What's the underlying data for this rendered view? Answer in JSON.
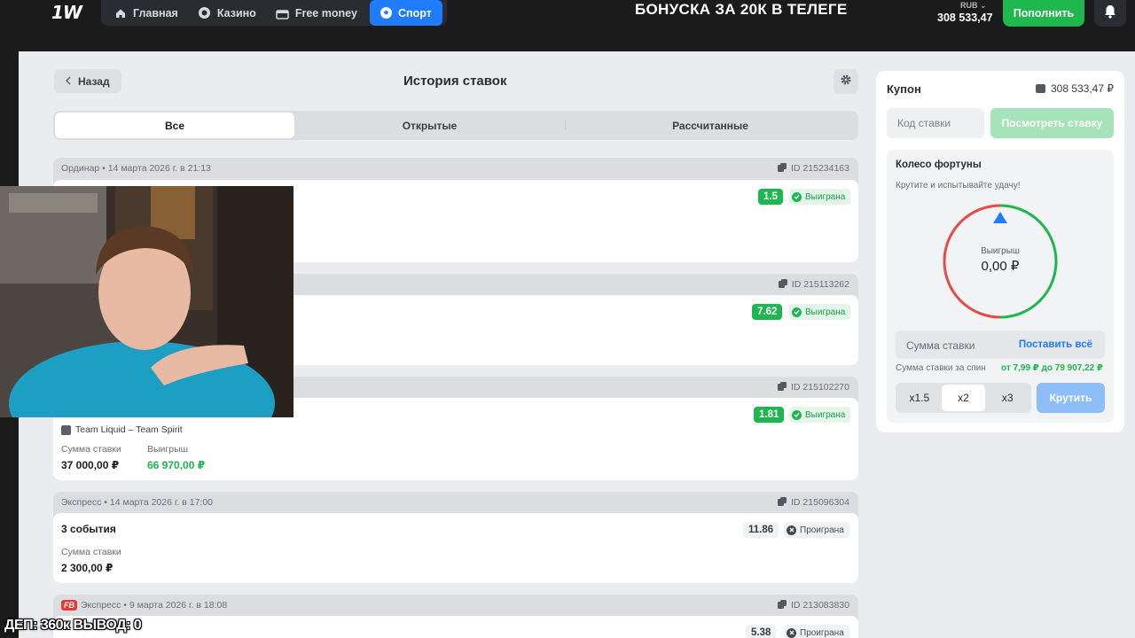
{
  "header": {
    "logo": "1W",
    "nav": [
      {
        "label": "Главная",
        "icon": "home-icon"
      },
      {
        "label": "Казино",
        "icon": "casino-chip-icon"
      },
      {
        "label": "Free money",
        "icon": "gift-icon"
      },
      {
        "label": "Спорт",
        "icon": "soccer-ball-icon",
        "active": true
      }
    ],
    "promo_text": "БОНУСКА ЗА 20К В ТЕЛЕГЕ",
    "balance_currency": "RUB",
    "balance_value": "308 533,47",
    "topup_label": "Пополнить",
    "accent_color": "#1f7bff",
    "success_color": "#1db650"
  },
  "page": {
    "back_label": "Назад",
    "title": "История ставок",
    "tabs": [
      {
        "label": "Все",
        "active": true
      },
      {
        "label": "Открытые"
      },
      {
        "label": "Рассчитанные"
      }
    ]
  },
  "bets": [
    {
      "head": "Ординар • 14 марта 2026 г. в 21:13",
      "id": "ID 215234163",
      "coef": "1.5",
      "status": "Выиграна"
    },
    {
      "id": "ID 215113262",
      "coef": "7.62",
      "status": "Выиграна"
    },
    {
      "id": "ID 215102270",
      "coef": "1.81",
      "status": "Выиграна",
      "match": "Team Liquid – Team Spirit",
      "stake_label": "Сумма ставки",
      "stake": "37 000,00 ₽",
      "win_label": "Выигрыш",
      "win": "66 970,00 ₽"
    },
    {
      "head": "Экспресс • 14 марта 2026 г. в 17:00",
      "id": "ID 215096304",
      "title": "3 события",
      "coef": "11.86",
      "status": "Проиграна",
      "stake_label": "Сумма ставки",
      "stake": "2 300,00 ₽"
    },
    {
      "badge": "FB",
      "head": "Экспресс • 9 марта 2026 г. в 18:08",
      "id": "ID 213083830",
      "coef": "5.38",
      "status": "Проиграна"
    }
  ],
  "coupon": {
    "title": "Купон",
    "balance": "308 533,47 ₽",
    "code_placeholder": "Код ставки",
    "view_label": "Посмотреть ставку",
    "wheel": {
      "title": "Колесо фортуны",
      "subtitle": "Крутите и испытывайте удачу!",
      "win_label": "Выигрыш",
      "win_value": "0,00 ₽"
    },
    "stake_placeholder": "Сумма ставки",
    "all_in_label": "Поставить всё",
    "range_label": "Сумма ставки за спин",
    "range_value": "от 7,99 ₽ до 79 907,22 ₽",
    "multipliers": [
      {
        "label": "x1.5"
      },
      {
        "label": "x2",
        "active": true
      },
      {
        "label": "x3"
      }
    ],
    "spin_label": "Крутить"
  },
  "overlay_text": "ДЕП: 360к ВЫВОД: 0"
}
